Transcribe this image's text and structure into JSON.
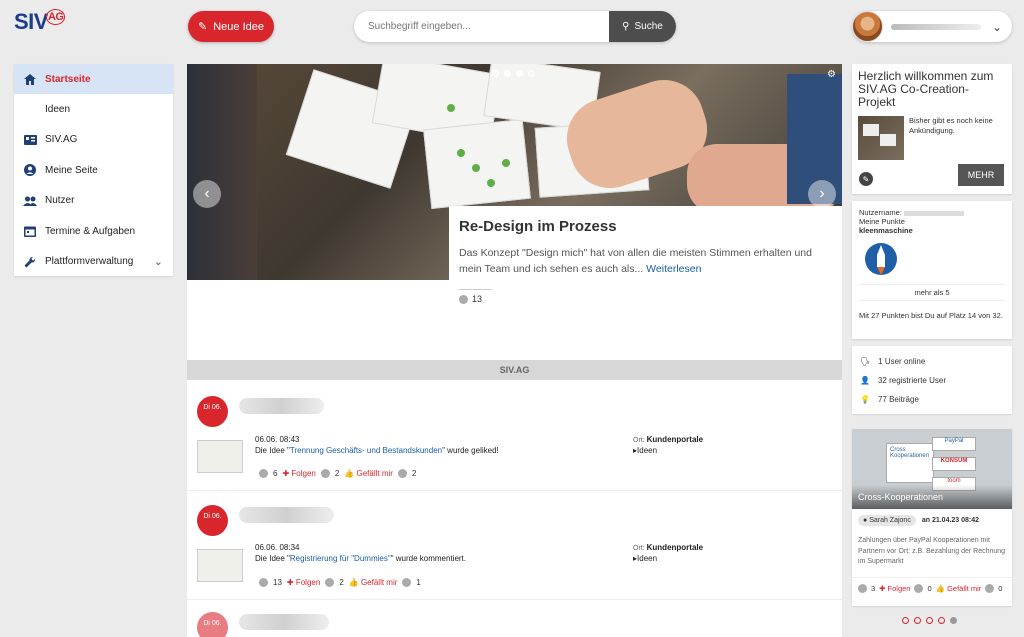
{
  "header": {
    "logo_main": "SIV",
    "logo_badge": "AG",
    "new_idea_label": "Neue Idee",
    "search_placeholder": "Suchbegriff eingeben...",
    "search_button_label": "Suche"
  },
  "sidebar": {
    "items": [
      {
        "label": "Startseite",
        "icon": "home-icon"
      },
      {
        "label": "Ideen",
        "icon": ""
      },
      {
        "label": "SIV.AG",
        "icon": "id-card-icon"
      },
      {
        "label": "Meine Seite",
        "icon": "user-circle-icon"
      },
      {
        "label": "Nutzer",
        "icon": "users-icon"
      },
      {
        "label": "Termine & Aufgaben",
        "icon": "calendar-icon"
      },
      {
        "label": "Plattformverwaltung",
        "icon": "wrench-icon"
      }
    ]
  },
  "hero": {
    "title": "Re-Design im Prozess",
    "text": "Das Konzept \"Design mich\" hat von allen die meisten Stimmen erhalten und mein Team und ich sehen es auch als...",
    "read_more": "Weiterlesen",
    "comment_count": "13"
  },
  "section_title": "SIV.AG",
  "feed": [
    {
      "badge": "Di 06.",
      "time": "06.06. 08:43",
      "msg_prefix": "Die Idee \"",
      "link": "Trennung Geschäfts- und Bestandskunden",
      "msg_suffix": "\" wurde geliked!",
      "ort_label": "Ort:",
      "ort_value": "Kundenportale",
      "tag": "Ideen",
      "comments": "6",
      "follow": "Folgen",
      "votes": "2",
      "like": "Gefällt mir",
      "likes": "2"
    },
    {
      "badge": "Di 06.",
      "time": "06.06. 08:34",
      "msg_prefix": "Die Idee \"",
      "link": "Registrierung für \"Dummies\"",
      "msg_suffix": "\" wurde kommentiert.",
      "ort_label": "Ort:",
      "ort_value": "Kundenportale",
      "tag": "Ideen",
      "comments": "13",
      "follow": "Folgen",
      "votes": "2",
      "like": "Gefällt mir",
      "likes": "1"
    },
    {
      "badge": "Di 06."
    }
  ],
  "welcome": {
    "title": "Herzlich willkommen zum SIV.AG Co-Creation-Projekt",
    "text": "Bisher gibt es noch keine Ankündigung.",
    "more": "MEHR"
  },
  "points": {
    "username_label": "Nutzername:",
    "points_label": "Meine Punkte",
    "points_title": "kleenmaschine",
    "threshold": "mehr als 5",
    "rank_text": "Mit 27 Punkten bist Du auf Platz 14 von 32."
  },
  "stats": {
    "online": "1 User online",
    "registered": "32 registrierte User",
    "posts": "77 Beiträge"
  },
  "promo": {
    "title": "Cross-Kooperationen",
    "author": "Sarah Zajonc",
    "date": "an 21.04.23 08:42",
    "text": "Zahlungen über PayPal Kooperationen mit Partnern vor Ort: z.B. Bezahlung der Rechnung im Supermarkt",
    "comments": "3",
    "follow": "Folgen",
    "votes": "0",
    "like": "Gefällt mir",
    "likes": "0",
    "img_labels": [
      "Cross",
      "Kooperationen",
      "PayPal",
      "KONSUM",
      "toom"
    ]
  },
  "colors": {
    "accent": "#d9262d",
    "brand": "#1a3e8c"
  }
}
